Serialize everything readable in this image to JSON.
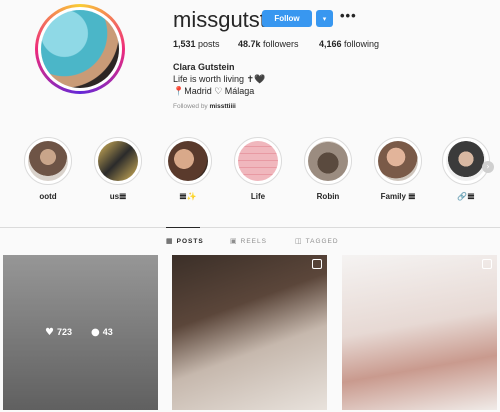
{
  "profile": {
    "username": "missgutstein",
    "follow_label": "Follow",
    "dropdown_icon": "▾",
    "more_icon": "•••",
    "posts_count": "1,531",
    "posts_label": "posts",
    "followers_count": "48.7k",
    "followers_label": "followers",
    "following_count": "4,166",
    "following_label": "following",
    "full_name": "Clara Gutstein",
    "bio_line1": "Life is worth living ✝🖤",
    "bio_line2": "📍Madrid ♡ Málaga",
    "followed_by_prefix": "Followed by",
    "followed_by_user": "missttiiii"
  },
  "highlights": [
    {
      "label": "ootd"
    },
    {
      "label": "us𝌆"
    },
    {
      "label": "𝌆✨"
    },
    {
      "label": "Life"
    },
    {
      "label": "Robin"
    },
    {
      "label": "Family 𝌆"
    },
    {
      "label": "🔗𝌆"
    }
  ],
  "next_icon": "›",
  "tabs": [
    {
      "label": "POSTS",
      "icon": "▦"
    },
    {
      "label": "REELS",
      "icon": "▣"
    },
    {
      "label": "TAGGED",
      "icon": "◫"
    }
  ],
  "posts": [
    {
      "likes": "723",
      "comments": "43"
    }
  ],
  "icons": {
    "heart": "♥",
    "comment": "●"
  },
  "colors": {
    "accent": "#3897f0"
  }
}
